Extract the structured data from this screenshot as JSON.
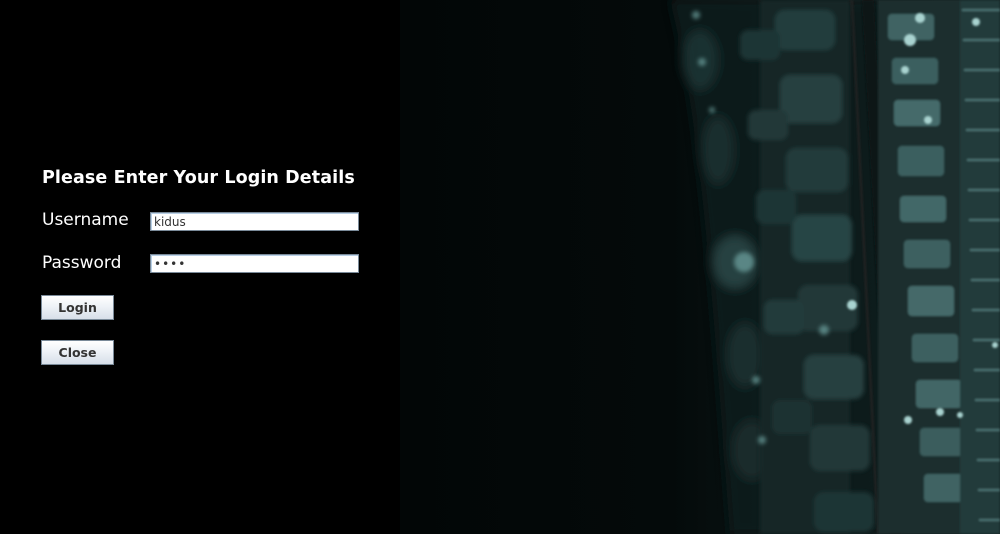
{
  "login": {
    "heading": "Please Enter Your Login Details",
    "username_label": "Username",
    "username_value": "kidus",
    "password_label": "Password",
    "password_value": "••••",
    "login_button": "Login",
    "close_button": "Close"
  },
  "theme": {
    "panel_background": "#000000",
    "text_color": "#ffffff",
    "photo_tint": "#1f3535"
  }
}
